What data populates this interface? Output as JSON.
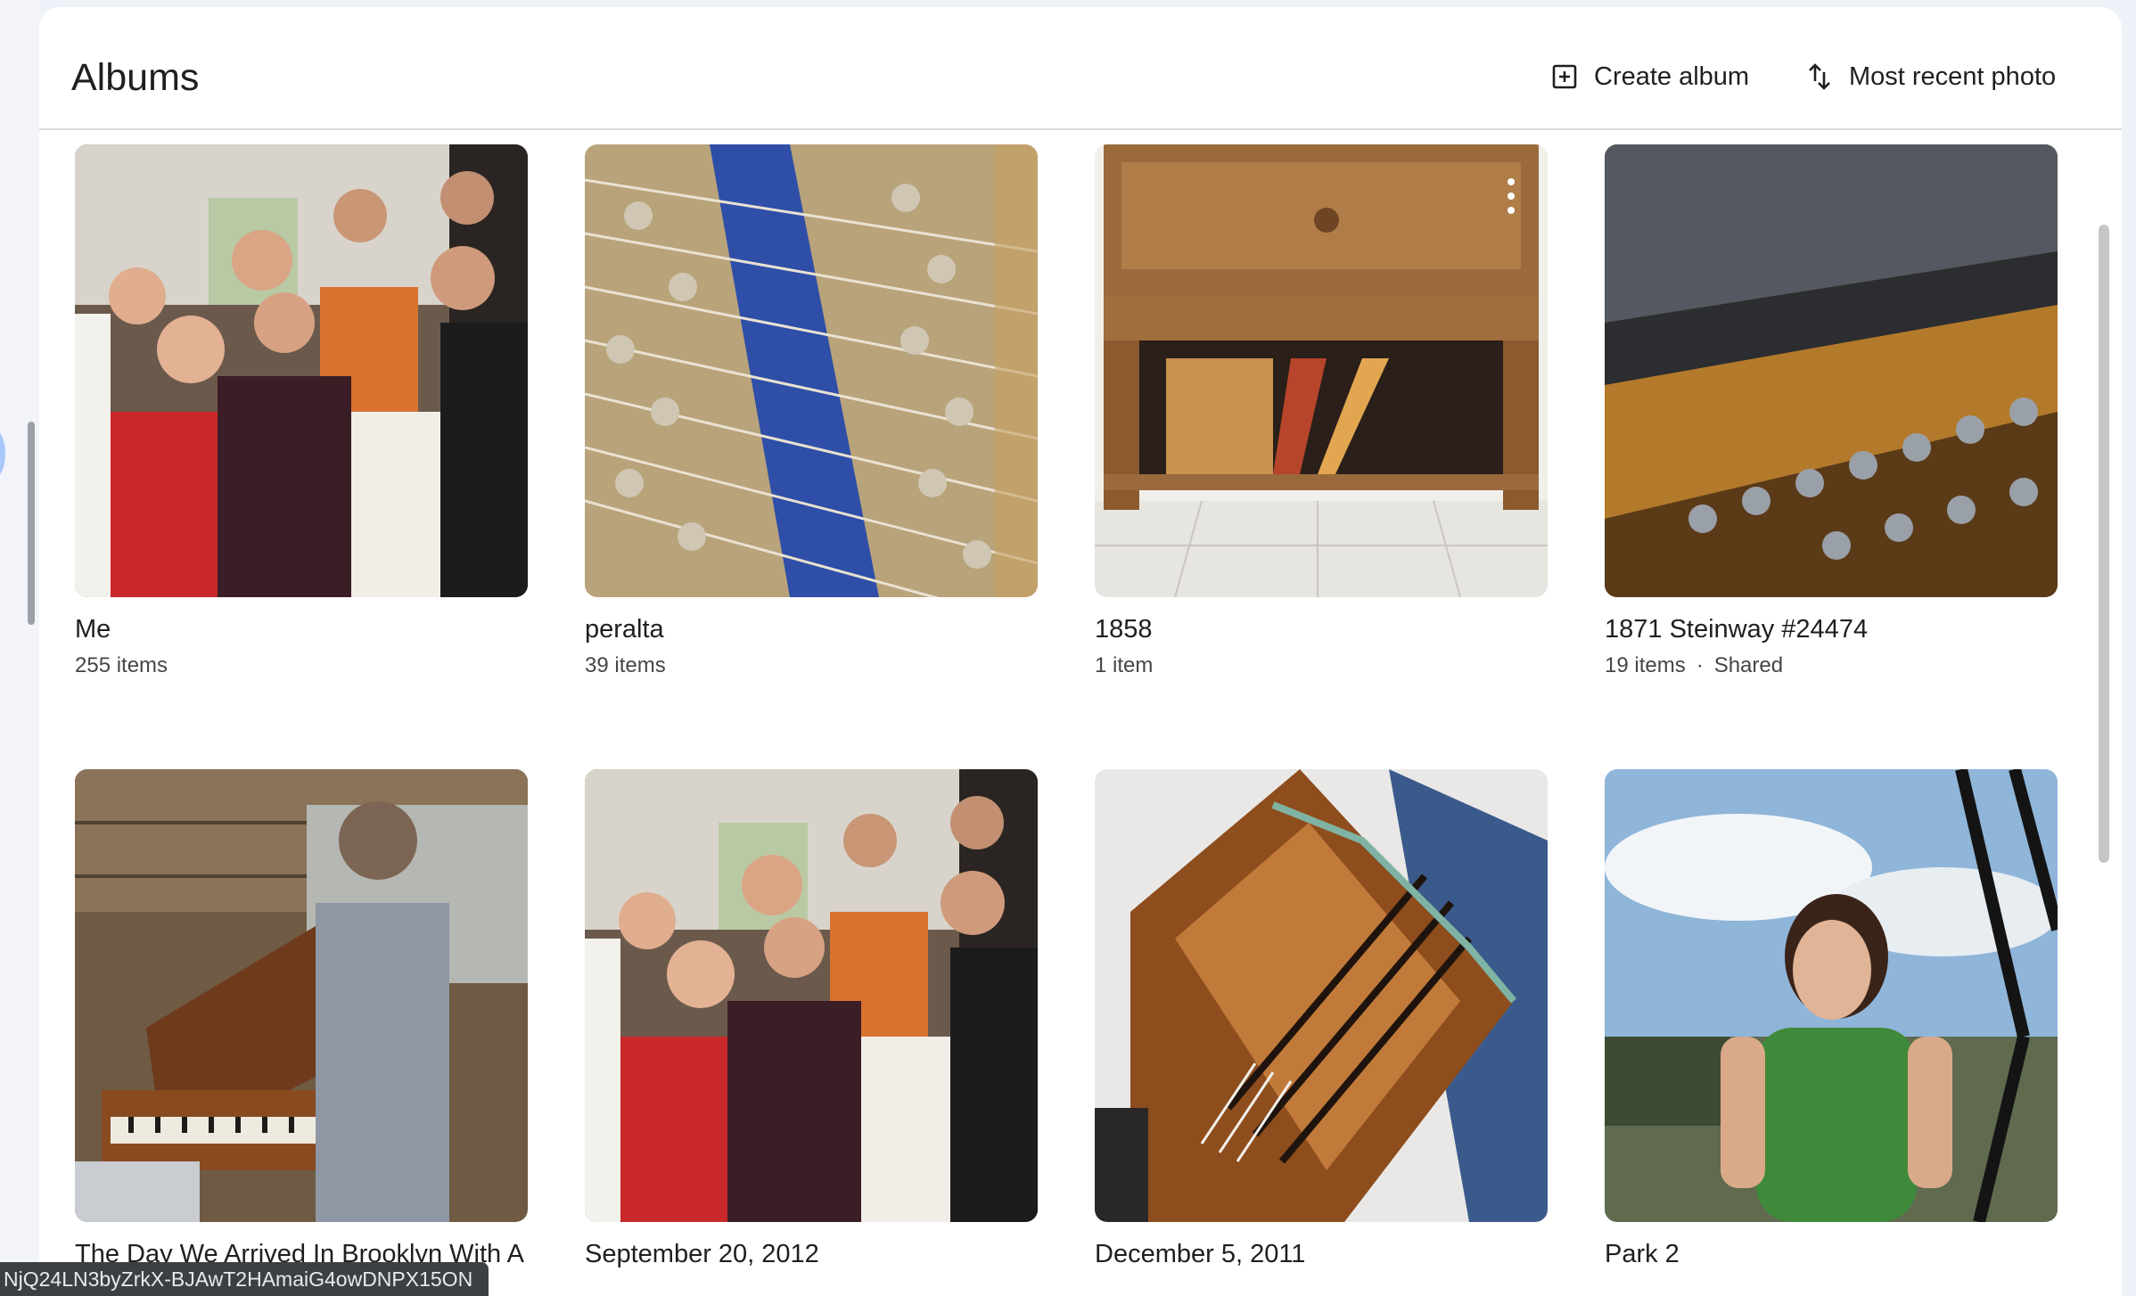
{
  "page": {
    "title": "Albums",
    "create_album_label": "Create album",
    "sort_label": "Most recent photo"
  },
  "albums": [
    {
      "title": "Me",
      "meta": "255 items",
      "shared": ""
    },
    {
      "title": "peralta",
      "meta": "39 items",
      "shared": ""
    },
    {
      "title": "1858",
      "meta": "1 item",
      "shared": ""
    },
    {
      "title": "1871 Steinway #24474",
      "meta": "19 items",
      "shared": "Shared"
    },
    {
      "title": "The Day We Arrived In Brooklyn With A",
      "meta": "",
      "shared": ""
    },
    {
      "title": "September 20, 2012",
      "meta": "",
      "shared": ""
    },
    {
      "title": "December 5, 2011",
      "meta": "",
      "shared": ""
    },
    {
      "title": "Park 2",
      "meta": "",
      "shared": ""
    }
  ],
  "status_bar": {
    "url_fragment": "NjQ24LN3byZrkX-BJAwT2HAmaiG4owDNPX15ON"
  },
  "icons": {
    "create": "add-box-icon",
    "sort": "swap-vert-icon",
    "more": "more-vert-icon"
  },
  "colors": {
    "background": "#eef1f7",
    "panel": "#ffffff",
    "text": "#1f1f1f",
    "secondary_text": "#444746"
  }
}
